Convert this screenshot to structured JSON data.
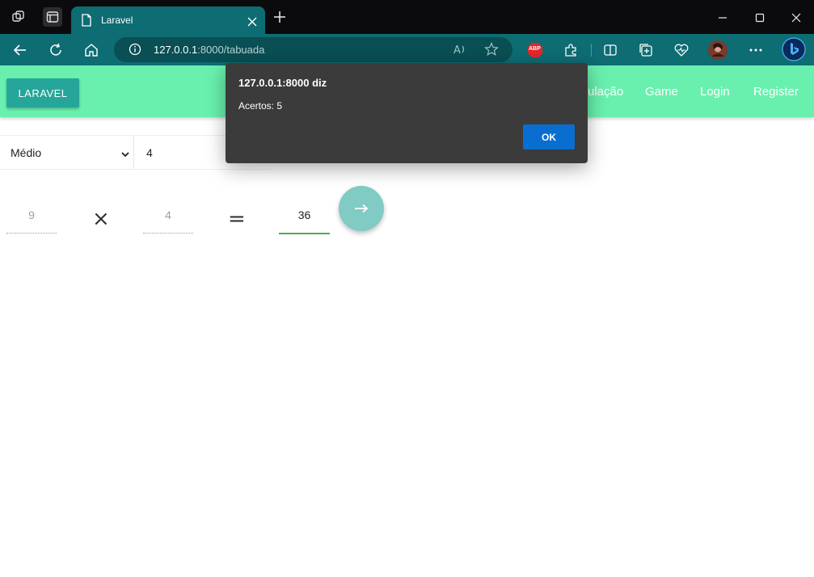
{
  "browser": {
    "tab_title": "Laravel",
    "address_host": "127.0.0.1",
    "address_rest": ":8000/tabuada",
    "icons": [
      "workspaces-icon",
      "tab-actions-icon",
      "page-icon",
      "close-icon",
      "new-tab-icon",
      "back-icon",
      "refresh-icon",
      "home-icon",
      "info-icon",
      "read-aloud-icon",
      "favorite-icon",
      "adblock-icon",
      "extensions-icon",
      "split-screen-icon",
      "collections-icon",
      "browser-essentials-icon",
      "profile-avatar",
      "more-icon",
      "bing-icon"
    ],
    "adblock_label": "ABP"
  },
  "navbar": {
    "brand": "LARAVEL",
    "links": [
      "ulação",
      "Game",
      "Login",
      "Register"
    ]
  },
  "form": {
    "difficulty": "Médio",
    "table_number": "4"
  },
  "equation": {
    "operand_a": "9",
    "times_symbol": "×",
    "operand_b": "4",
    "equals_symbol": "=",
    "answer": "36"
  },
  "dialog": {
    "title": "127.0.0.1:8000 diz",
    "message": "Acertos: 5",
    "ok_label": "OK"
  },
  "colors": {
    "navbar": "#69f0ae",
    "brand_button": "#26a69a",
    "fab": "#80cbc4",
    "browser_toolbar": "#0e6c73",
    "dialog_bg": "#3b3b3b",
    "ok_button": "#0a6ed1"
  }
}
